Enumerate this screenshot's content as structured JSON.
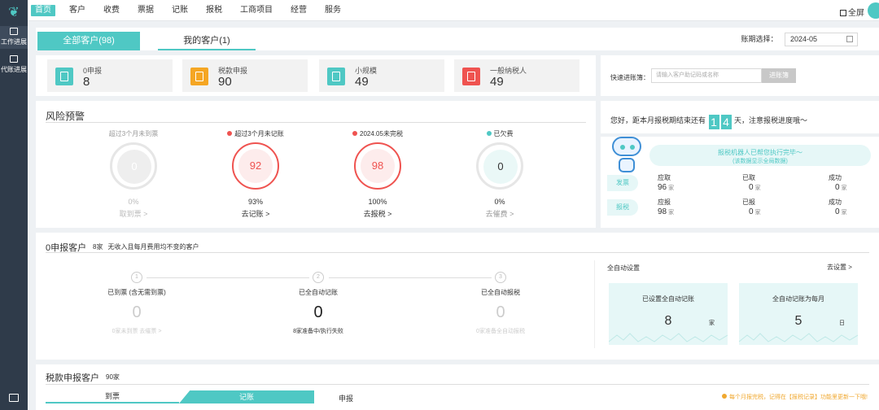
{
  "sidebar": {
    "items": [
      {
        "label": "工作进展",
        "icon": "chart-icon"
      },
      {
        "label": "代账进展",
        "icon": "list-icon"
      }
    ]
  },
  "topbar": {
    "nav": [
      "首页",
      "客户",
      "收费",
      "票据",
      "记账",
      "报税",
      "工商项目",
      "经营",
      "服务"
    ],
    "active": "首页",
    "fullscreen": "全屏"
  },
  "tabs": {
    "all": "全部客户(98)",
    "mine": "我的客户(1)",
    "period_label": "账期选择：",
    "period_value": "2024-05"
  },
  "stats": [
    {
      "label": "0申报",
      "value": "8",
      "color": "#4fc8c4"
    },
    {
      "label": "税款申报",
      "value": "90",
      "color": "#f5a623"
    },
    {
      "label": "小规模",
      "value": "49",
      "color": "#4fc8c4"
    },
    {
      "label": "一般纳税人",
      "value": "49",
      "color": "#ef5350"
    }
  ],
  "quick": {
    "label": "快速进账簿：",
    "placeholder": "请输入客户助记码或名称",
    "button": "进账簿"
  },
  "risk": {
    "title": "风险预警",
    "gauges": [
      {
        "title": "超过3个月未到票",
        "value": "0",
        "pct": "0%",
        "action": "取到票 >",
        "alert": false,
        "color": "#999999"
      },
      {
        "title": "超过3个月未记账",
        "value": "92",
        "pct": "93%",
        "action": "去记账 >",
        "alert": true,
        "color": "#ef5350"
      },
      {
        "title": "2024.05未完税",
        "value": "98",
        "pct": "100%",
        "action": "去报税 >",
        "alert": true,
        "color": "#ef5350"
      },
      {
        "title": "已欠费",
        "value": "0",
        "pct": "0%",
        "action": "去催费 >",
        "alert": false,
        "color": "#4fc8c4"
      }
    ]
  },
  "countdown": {
    "prefix": "您好，距本月报税期结束还有",
    "d1": "1",
    "d2": "4",
    "suffix": "天，注意报税进度哦～"
  },
  "robot": {
    "line1": "报税机器人已帮您执行完毕～",
    "line2": "(该数据显示全局数据)",
    "rows": [
      {
        "tag": "发票",
        "c1": "应取",
        "v1": "96",
        "c2": "已取",
        "v2": "0",
        "c3": "成功",
        "v3": "0"
      },
      {
        "tag": "报税",
        "c1": "应报",
        "v1": "98",
        "c2": "已报",
        "v2": "0",
        "c3": "成功",
        "v3": "0"
      }
    ],
    "unit": "家"
  },
  "zero": {
    "title": "0申报客户",
    "count": "8家",
    "desc": "无收入且每月费用均不变的客户",
    "steps": [
      {
        "num": "1",
        "label": "已到票 (含无需到票)",
        "value": "0",
        "foot": "0家未到票    去催票 >"
      },
      {
        "num": "2",
        "label": "已全自动记账",
        "value": "0",
        "foot": "8家准备中/执行失败"
      },
      {
        "num": "3",
        "label": "已全自动报税",
        "value": "0",
        "foot": "0家准备全自动报税"
      }
    ],
    "auto_title": "全自动设置",
    "auto_link": "去设置 >",
    "cards": [
      {
        "label": "已设置全自动记账",
        "value": "8",
        "unit": "家"
      },
      {
        "label": "全自动记账为每月",
        "value": "5",
        "unit": "日"
      }
    ]
  },
  "tax": {
    "title": "税款申报客户",
    "count": "90家",
    "tab1": "到票",
    "tab2": "记账",
    "decl": "申报",
    "notice": "每个月报完税，记得在【报税记录】功能里更新一下哦!"
  }
}
